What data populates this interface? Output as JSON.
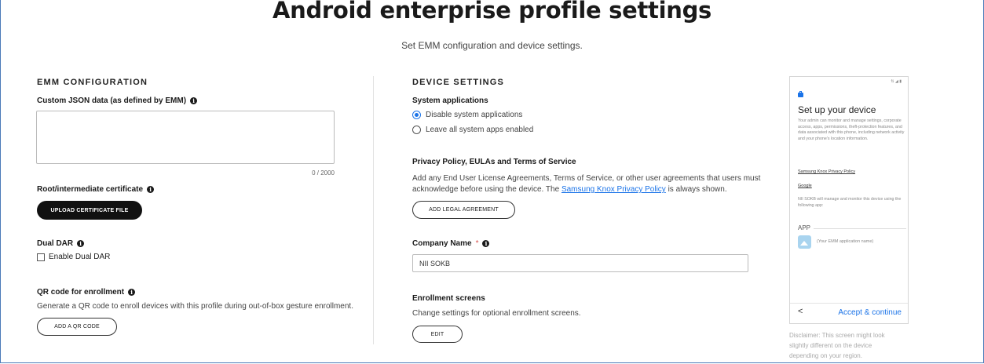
{
  "header": {
    "title": "Android enterprise profile settings",
    "subtitle": "Set EMM configuration and device settings."
  },
  "emm": {
    "heading": "EMM CONFIGURATION",
    "custom_json_label": "Custom JSON data (as defined by EMM)",
    "custom_json_value": "",
    "counter": "0 / 2000",
    "cert_label": "Root/intermediate certificate",
    "upload_button": "UPLOAD CERTIFICATE FILE",
    "dual_dar_label": "Dual DAR",
    "enable_dual_dar": "Enable Dual DAR",
    "enable_dual_dar_checked": false,
    "qr_label": "QR code for enrollment",
    "qr_desc": "Generate a QR code to enroll devices with this profile during out-of-box gesture enrollment.",
    "qr_button": "ADD A QR CODE"
  },
  "device": {
    "heading": "DEVICE SETTINGS",
    "system_apps_label": "System applications",
    "radio_disable": "Disable system applications",
    "radio_leave": "Leave all system apps enabled",
    "selected_option": "Disable system applications",
    "privacy_label": "Privacy Policy, EULAs and Terms of Service",
    "privacy_desc_1": "Add any End User License Agreements, Terms of Service, or other user agreements that users must",
    "privacy_desc_2a": "acknowledge before using the device. The ",
    "privacy_link": "Samsung Knox Privacy Policy",
    "privacy_desc_2b": " is always shown.",
    "legal_button": "ADD LEGAL AGREEMENT",
    "company_label": "Company Name",
    "required_mark": "*",
    "company_value": "NII SOKB",
    "enroll_label": "Enrollment screens",
    "enroll_desc": "Change settings for optional enrollment screens.",
    "edit_button": "EDIT"
  },
  "preview": {
    "status": "⇅ ◢ ▮",
    "title": "Set up your device",
    "body": "Your admin can monitor and manage settings, corporate access, apps, permissions, theft-protection features, and data associated with this phone, including network activity and your phone's location information.",
    "link_privacy": "Samsung Knox Privacy Policy",
    "link_google": "Google",
    "manage_text": "NII SOKB will manage and monitor this device using the following app:",
    "app_heading": "APP",
    "app_name": "(Your EMM application name)",
    "back": "<",
    "continue": "Accept & continue",
    "disclaimer": "Disclaimer: This screen might look slightly different on the device depending on your region."
  },
  "colors": {
    "accent": "#1a73e8",
    "button_dark": "#111111",
    "required": "#d9534f",
    "frame": "#4a7ab8"
  },
  "icons": [
    "info-icon",
    "briefcase-icon",
    "image-icon",
    "back-icon"
  ]
}
